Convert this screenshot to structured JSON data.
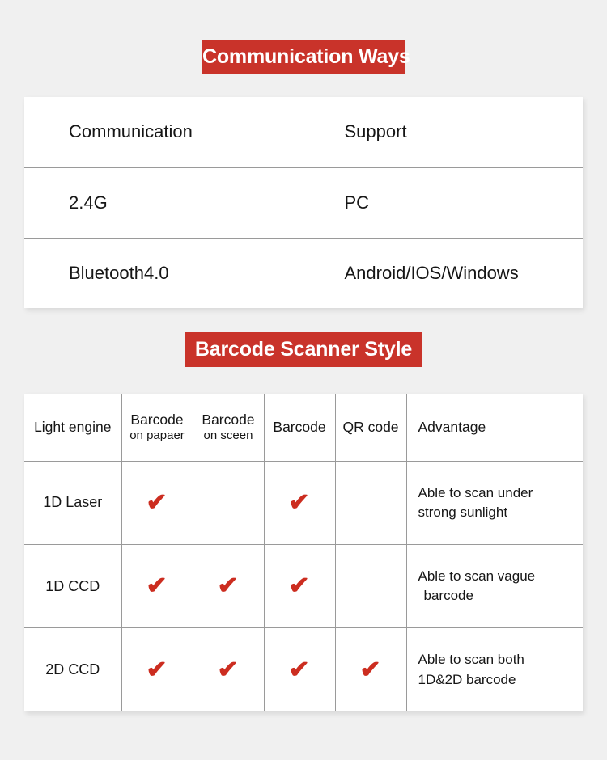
{
  "sections": [
    {
      "banner": "Communication Ways",
      "table": {
        "rows": [
          {
            "c1": "Communication",
            "c2": "Support"
          },
          {
            "c1": "2.4G",
            "c2": "PC"
          },
          {
            "c1": "Bluetooth4.0",
            "c2": "Android/IOS/Windows"
          }
        ]
      }
    },
    {
      "banner": "Barcode Scanner Style",
      "table": {
        "headers": {
          "engine": "Light engine",
          "paper_l1": "Barcode",
          "paper_l2": "on papaer",
          "screen_l1": "Barcode",
          "screen_l2": "on sceen",
          "barcode": "Barcode",
          "qr": "QR code",
          "advantage": "Advantage"
        },
        "rows": [
          {
            "engine": "1D Laser",
            "paper": "✔",
            "screen": "",
            "barcode": "✔",
            "qr": "",
            "adv_l1": "Able to scan under",
            "adv_l2": "strong sunlight",
            "adv_l2_indent": false
          },
          {
            "engine": "1D CCD",
            "paper": "✔",
            "screen": "✔",
            "barcode": "✔",
            "qr": "",
            "adv_l1": "Able to scan vague",
            "adv_l2": "barcode",
            "adv_l2_indent": true
          },
          {
            "engine": "2D CCD",
            "paper": "✔",
            "screen": "✔",
            "barcode": "✔",
            "qr": "✔",
            "adv_l1": "Able to scan both",
            "adv_l2": "1D&2D barcode",
            "adv_l2_indent": false
          }
        ]
      }
    }
  ],
  "colors": {
    "banner_red": "#c9332a",
    "check_red": "#cc2d20",
    "page_background": "#f0f0f0",
    "table_background": "#ffffff",
    "border": "#9a9a9a"
  }
}
